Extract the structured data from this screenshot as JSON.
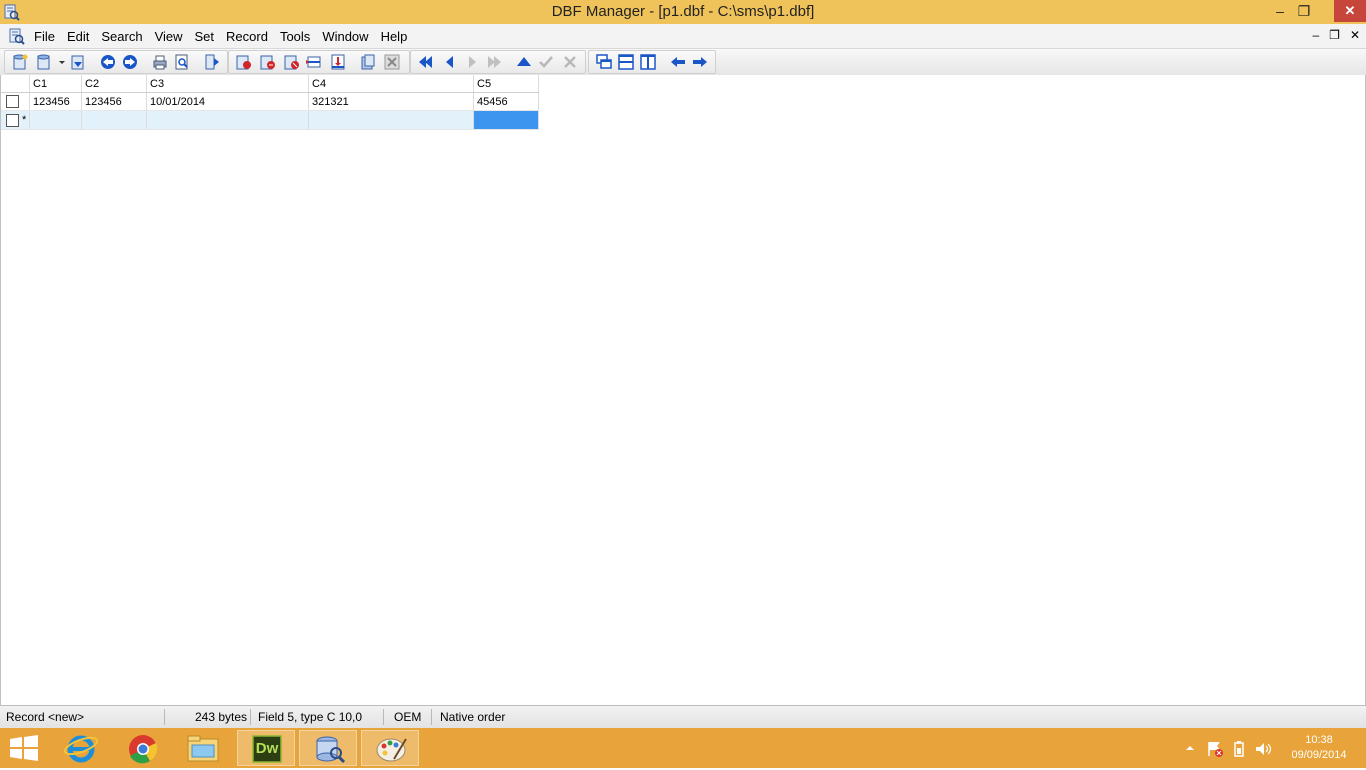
{
  "window": {
    "title": "DBF Manager - [p1.dbf - C:\\sms\\p1.dbf]",
    "controls": {
      "minimize": "–",
      "restore": "❐",
      "close": "✕"
    }
  },
  "menu": {
    "items": [
      "File",
      "Edit",
      "Search",
      "View",
      "Set",
      "Record",
      "Tools",
      "Window",
      "Help"
    ],
    "mdi_controls": {
      "minimize": "–",
      "restore": "❐",
      "close": "✕"
    }
  },
  "grid": {
    "columns": [
      "C1",
      "C2",
      "C3",
      "C4",
      "C5"
    ],
    "rows": [
      [
        "123456",
        "123456",
        "10/01/2014",
        "321321",
        "45456"
      ]
    ],
    "new_row_marker": "*"
  },
  "status": {
    "record": "Record <new>",
    "size": "243 bytes",
    "field": "Field 5, type C 10,0",
    "charset": "OEM",
    "order": "Native order"
  },
  "taskbar": {
    "items": [
      "start-icon",
      "internet-explorer-icon",
      "chrome-icon",
      "file-explorer-icon",
      "dreamweaver-icon",
      "dbf-manager-icon",
      "paint-icon"
    ],
    "dreamweaver_label": "Dw",
    "clock_time": "10:38",
    "clock_date": "09/09/2014"
  },
  "colors": {
    "titlebar": "#f0c35a",
    "taskbar": "#e8a43a",
    "selection": "#3d95f0",
    "new_row": "#e3f1fb",
    "close_button": "#c7463b",
    "toolbar_blue": "#1b56c9"
  }
}
